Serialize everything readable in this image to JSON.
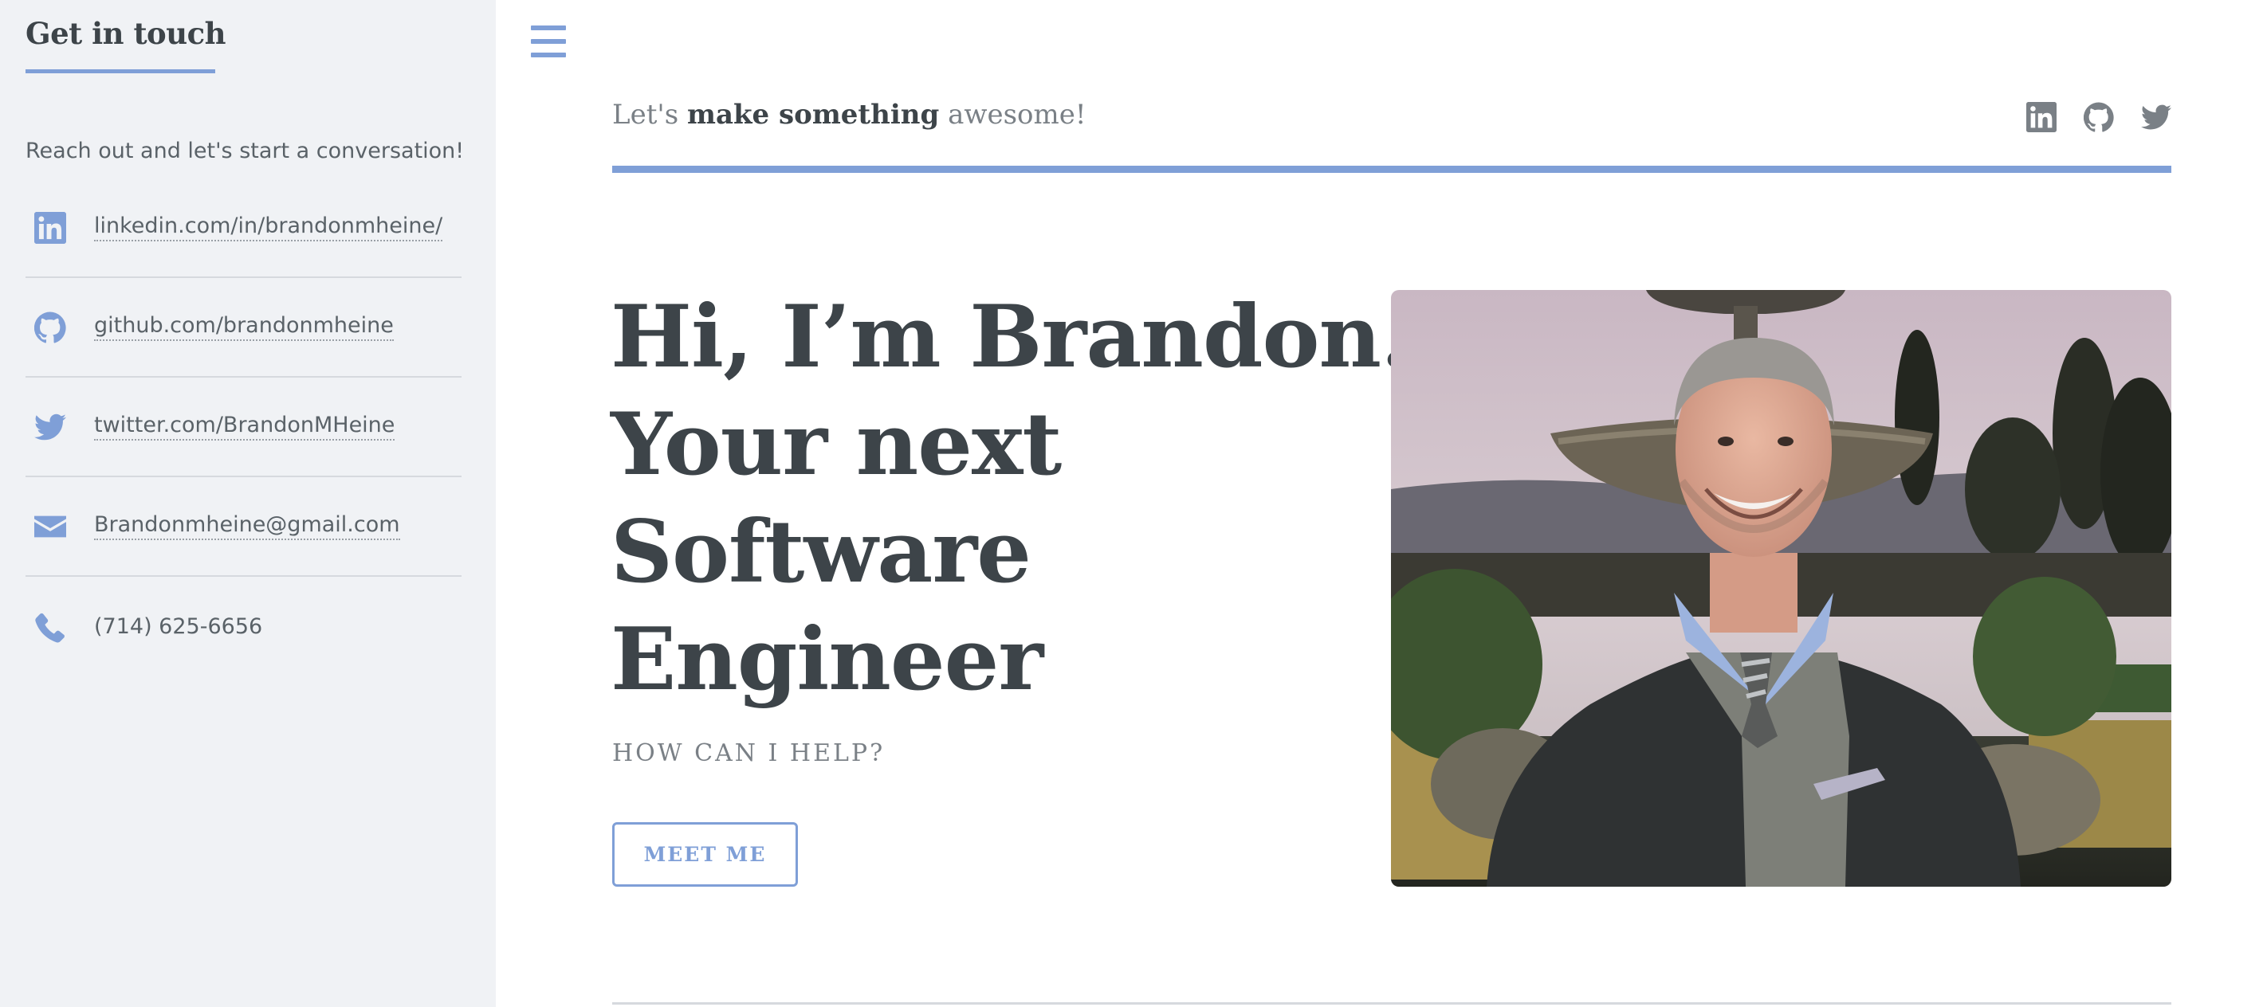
{
  "sidebar": {
    "title": "Get in touch",
    "intro": "Reach out and let's start a conversation!",
    "contacts": [
      {
        "icon": "linkedin-icon",
        "text": "linkedin.com/in/brandonmheine/"
      },
      {
        "icon": "github-icon",
        "text": "github.com/brandonmheine"
      },
      {
        "icon": "twitter-icon",
        "text": "twitter.com/BrandonMHeine"
      },
      {
        "icon": "envelope-icon",
        "text": "Brandonmheine@gmail.com"
      },
      {
        "icon": "phone-icon",
        "text": "(714) 625-6656"
      }
    ]
  },
  "header": {
    "tagline_pre": "Let's ",
    "tagline_bold": "make something",
    "tagline_post": " awesome!",
    "social_icons": [
      "linkedin-icon",
      "github-icon",
      "twitter-icon"
    ]
  },
  "hero": {
    "title_lines": [
      "Hi, I’m Brandon.",
      "Your next",
      "Software",
      "Engineer"
    ],
    "subtitle": "HOW CAN I HELP?",
    "button_label": "MEET ME"
  },
  "colors": {
    "accent": "#7f9fd7",
    "sidebar_bg": "#f0f2f5",
    "text_dark": "#3d4449",
    "text_muted": "#7a8086"
  }
}
